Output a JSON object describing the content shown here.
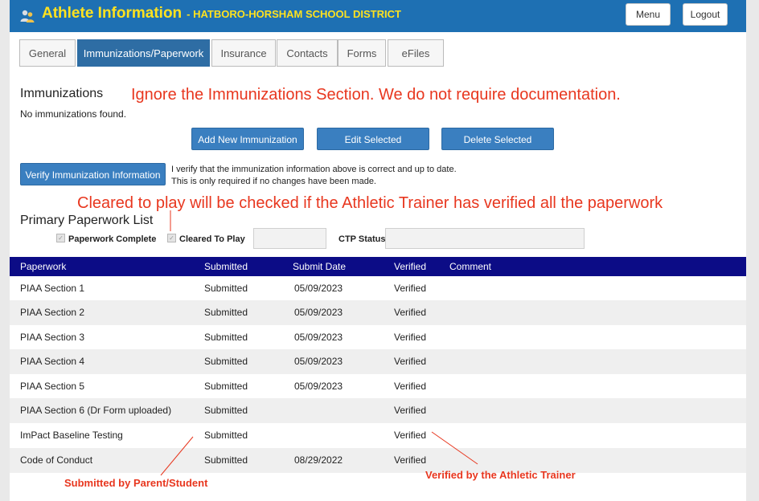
{
  "header": {
    "title": "Athlete Information",
    "district": "- HATBORO-HORSHAM SCHOOL DISTRICT",
    "menu_label": "Menu",
    "logout_label": "Logout"
  },
  "tabs": [
    {
      "label": "General"
    },
    {
      "label": "Immunizations/Paperwork"
    },
    {
      "label": "Insurance"
    },
    {
      "label": "Contacts"
    },
    {
      "label": "Forms"
    },
    {
      "label": "eFiles"
    }
  ],
  "immunizations": {
    "heading": "Immunizations",
    "empty_text": "No immunizations found.",
    "add_label": "Add New Immunization",
    "edit_label": "Edit Selected",
    "delete_label": "Delete Selected",
    "verify_label": "Verify Immunization Information",
    "verify_note_1": "I verify that the immunization information above is correct and up to date.",
    "verify_note_2": "This is only required if no changes have been made."
  },
  "annotations": {
    "immunizations_note": "Ignore the Immunizations Section. We do not require documentation.",
    "cleared_note": "Cleared to play will be checked if the Athletic Trainer has verified all the paperwork",
    "submitted_note": "Submitted by Parent/Student",
    "verified_note": "Verified by the Athletic Trainer"
  },
  "paperwork": {
    "heading": "Primary Paperwork List",
    "complete_label": "Paperwork Complete",
    "cleared_label": "Cleared To Play",
    "ctp_label": "CTP Status",
    "columns": [
      "Paperwork",
      "Submitted",
      "Submit Date",
      "Verified",
      "Comment"
    ],
    "rows": [
      {
        "name": "PIAA Section 1",
        "submitted": "Submitted",
        "date": "05/09/2023",
        "verified": "Verified",
        "comment": ""
      },
      {
        "name": "PIAA Section 2",
        "submitted": "Submitted",
        "date": "05/09/2023",
        "verified": "Verified",
        "comment": ""
      },
      {
        "name": "PIAA Section 3",
        "submitted": "Submitted",
        "date": "05/09/2023",
        "verified": "Verified",
        "comment": ""
      },
      {
        "name": "PIAA Section 4",
        "submitted": "Submitted",
        "date": "05/09/2023",
        "verified": "Verified",
        "comment": ""
      },
      {
        "name": "PIAA Section 5",
        "submitted": "Submitted",
        "date": "05/09/2023",
        "verified": "Verified",
        "comment": ""
      },
      {
        "name": "PIAA Section 6 (Dr Form uploaded)",
        "submitted": "Submitted",
        "date": "",
        "verified": "Verified",
        "comment": ""
      },
      {
        "name": "ImPact Baseline Testing",
        "submitted": "Submitted",
        "date": "",
        "verified": "Verified",
        "comment": ""
      },
      {
        "name": "Code of Conduct",
        "submitted": "Submitted",
        "date": "08/29/2022",
        "verified": "Verified",
        "comment": ""
      }
    ]
  }
}
